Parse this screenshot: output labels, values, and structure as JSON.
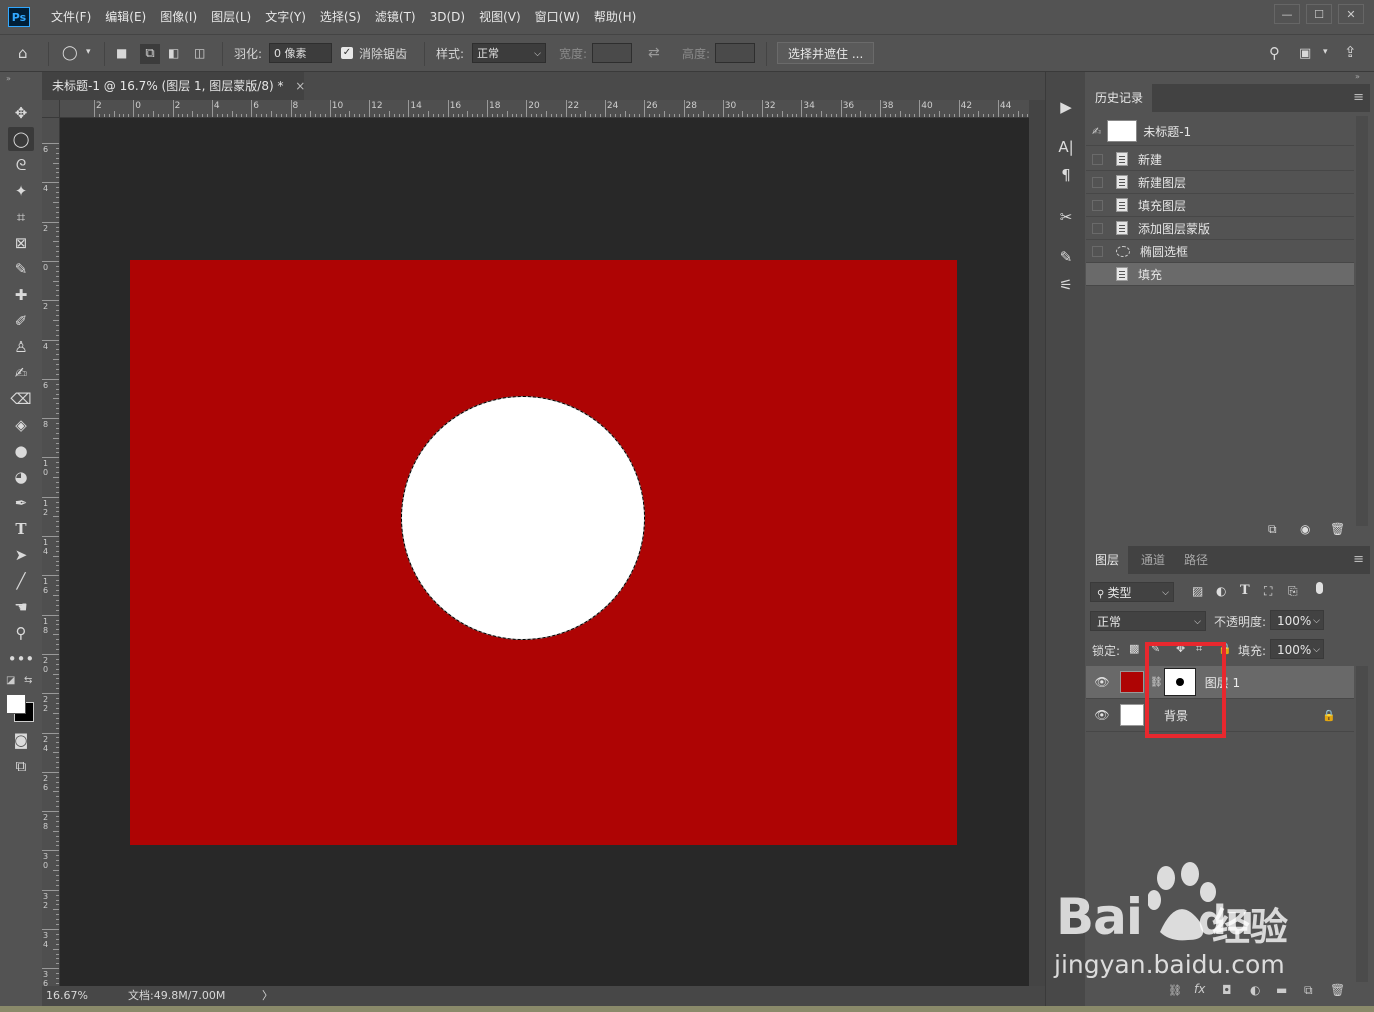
{
  "menubar": {
    "logo": "Ps",
    "items": [
      "文件(F)",
      "编辑(E)",
      "图像(I)",
      "图层(L)",
      "文字(Y)",
      "选择(S)",
      "滤镜(T)",
      "3D(D)",
      "视图(V)",
      "窗口(W)",
      "帮助(H)"
    ]
  },
  "options": {
    "feather_label": "羽化:",
    "feather_value": "0 像素",
    "antialias_label": "消除锯齿",
    "style_label": "样式:",
    "style_value": "正常",
    "width_label": "宽度:",
    "height_label": "高度:",
    "select_mask_button": "选择并遮住 ..."
  },
  "document": {
    "tab_title": "未标题-1 @ 16.7% (图层 1, 图层蒙版/8) *",
    "close": "×",
    "canvas_color": "#ae0404",
    "shape_color": "#ffffff",
    "ruler_h": [
      "2",
      "0",
      "2",
      "4",
      "6",
      "8",
      "10",
      "12",
      "14",
      "16",
      "18",
      "20",
      "22",
      "24",
      "26",
      "28",
      "30",
      "32",
      "34",
      "36",
      "38",
      "40",
      "42",
      "44"
    ],
    "ruler_v": [
      "6",
      "4",
      "2",
      "0",
      "2",
      "4",
      "6",
      "8",
      "10",
      "12",
      "14",
      "16",
      "18",
      "20",
      "22",
      "24",
      "26",
      "28",
      "30",
      "32",
      "34",
      "36"
    ]
  },
  "status": {
    "zoom": "16.67%",
    "doc_info": "文档:49.8M/7.00M",
    "arrow": "〉"
  },
  "history": {
    "tab": "历史记录",
    "snapshot": "未标题-1",
    "items": [
      "新建",
      "新建图层",
      "填充图层",
      "添加图层蒙版",
      "椭圆选框",
      "填充"
    ]
  },
  "layers": {
    "tabs": [
      "图层",
      "通道",
      "路径"
    ],
    "filter": "类型",
    "blend_mode": "正常",
    "opacity_label": "不透明度:",
    "opacity_value": "100%",
    "lock_label": "锁定:",
    "fill_label": "填充:",
    "fill_value": "100%",
    "rows": [
      {
        "name": "图层 1",
        "thumb_color": "#ae0404"
      },
      {
        "name": "背景",
        "thumb_color": "#ffffff"
      }
    ]
  },
  "watermark": {
    "brand": "Bai",
    "brand2": "du",
    "cn": "经验",
    "url": "jingyan.baidu.com"
  }
}
